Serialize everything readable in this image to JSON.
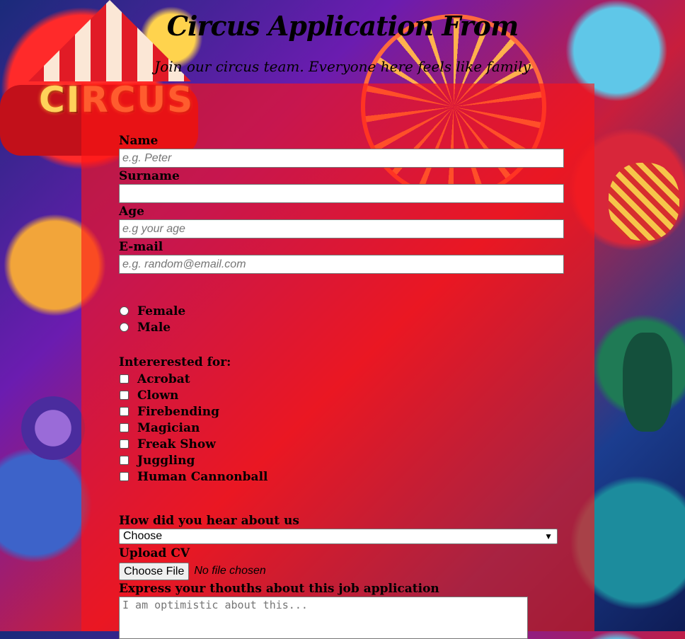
{
  "page": {
    "title": "Circus Application From",
    "subtitle": "Join our circus team. Everyone here feels like family"
  },
  "form": {
    "name": {
      "label": "Name",
      "placeholder": "e.g. Peter"
    },
    "surname": {
      "label": "Surname",
      "placeholder": ""
    },
    "age": {
      "label": "Age",
      "placeholder": "e.g your age"
    },
    "email": {
      "label": "E-mail",
      "placeholder": "e.g. random@email.com"
    },
    "gender_options": [
      "Female",
      "Male"
    ],
    "interests_label": "Intererested for:",
    "interests": [
      "Acrobat",
      "Clown",
      "Firebending",
      "Magician",
      "Freak Show",
      "Juggling",
      "Human Cannonball"
    ],
    "referral": {
      "label": "How did you hear about us",
      "selected": "Choose"
    },
    "cv": {
      "label": "Upload CV",
      "button": "Choose File",
      "status": "No file chosen"
    },
    "thoughts": {
      "label": "Express your thouths about this job application",
      "placeholder": "I am optimistic about this..."
    }
  },
  "background": {
    "sign_text": "CIRCUS"
  }
}
